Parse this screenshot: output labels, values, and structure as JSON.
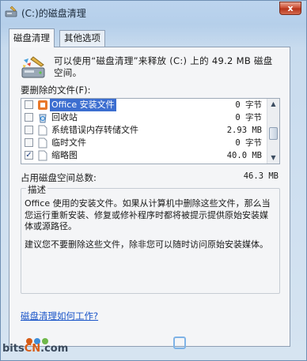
{
  "window": {
    "title": "(C:)的磁盘清理",
    "close_glyph": "x"
  },
  "tabs": [
    {
      "label": "磁盘清理",
      "active": true
    },
    {
      "label": "其他选项",
      "active": false
    }
  ],
  "intro_text": "可以使用“磁盘清理”来释放  (C:) 上的 49.2 MB 磁盘空间。",
  "files_label": "要删除的文件(F):",
  "files": [
    {
      "name": "Office 安装文件",
      "size": "0 字节",
      "checked": false,
      "icon": "office-install-icon",
      "selected": true
    },
    {
      "name": "回收站",
      "size": "0 字节",
      "checked": false,
      "icon": "recycle-bin-icon"
    },
    {
      "name": "系统错误内存转储文件",
      "size": "2.93 MB",
      "checked": false,
      "icon": "blank-file-icon"
    },
    {
      "name": "临时文件",
      "size": "0 字节",
      "checked": false,
      "icon": "blank-file-icon"
    },
    {
      "name": "缩略图",
      "size": "40.0 MB",
      "checked": true,
      "icon": "blank-file-icon"
    }
  ],
  "total": {
    "label": "占用磁盘空间总数:",
    "value": "46.3 MB"
  },
  "description": {
    "title": "描述",
    "paragraph1": "Office 使用的安装文件。如果从计算机中删除这些文件，那么当您运行重新安装、修复或修补程序时都将被提示提供原始安装媒体或源路径。",
    "paragraph2": "建议您不要删除这些文件，除非您可以随时访问原始安装媒体。"
  },
  "help_link": "磁盘清理如何工作?",
  "watermark": {
    "prefix": "bits",
    "highlight": "CN",
    "suffix": ".com"
  },
  "colors": {
    "selection": "#3c6ed0",
    "link": "#1a55c8",
    "close_button": "#c9472c"
  }
}
